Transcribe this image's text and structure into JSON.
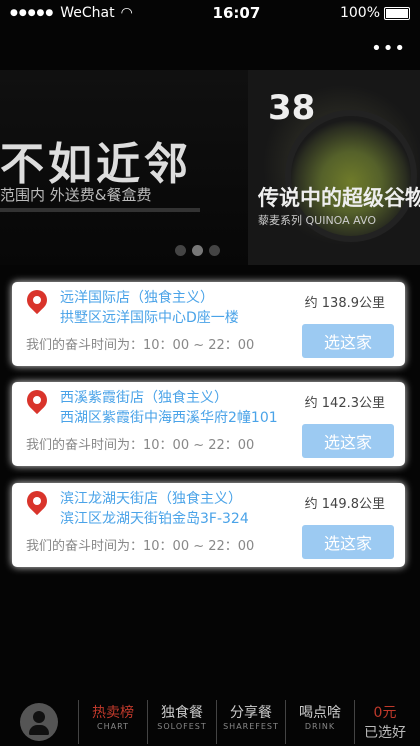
{
  "status_bar": {
    "signal": "●●●●●",
    "carrier": "WeChat",
    "time": "16:07",
    "battery": "100%"
  },
  "menu_icon": "more-dots-icon",
  "banner": {
    "headline": "不如近邻",
    "subline": "范围内  外送费&餐盒费",
    "promo_number": "38",
    "promo_title": "传说中的超级谷物",
    "promo_sub": "藜麦系列 QUINOA AVO",
    "carousel_total": 3,
    "carousel_active": 2
  },
  "stores": [
    {
      "name": "远洋国际店（独食主义）",
      "address": "拱墅区远洋国际中心D座一楼",
      "hours": "我们的奋斗时间为：10：00 ~ 22：00",
      "distance": "约 138.9公里",
      "button": "选这家"
    },
    {
      "name": "西溪紫霞街店（独食主义）",
      "address": "西湖区紫霞街中海西溪华府2幢101",
      "hours": "我们的奋斗时间为：10：00 ~ 22：00",
      "distance": "约 142.3公里",
      "button": "选这家"
    },
    {
      "name": "滨江龙湖天街店（独食主义）",
      "address": "滨江区龙湖天街铂金岛3F-324",
      "hours": "我们的奋斗时间为：10：00 ~ 22：00",
      "distance": "约 149.8公里",
      "button": "选这家"
    }
  ],
  "tabs": [
    {
      "cn": "热卖榜",
      "en": "CHART"
    },
    {
      "cn": "独食餐",
      "en": "SOLOFEST"
    },
    {
      "cn": "分享餐",
      "en": "SHAREFEST"
    },
    {
      "cn": "喝点啥",
      "en": "DRINK"
    }
  ],
  "cart": {
    "price": "0元",
    "label": "已选好"
  },
  "colors": {
    "accent_blue": "#4aa3e8",
    "button_bg": "#9ccaf2",
    "pin_red": "#d9342b",
    "active_tab": "#c0392b"
  }
}
